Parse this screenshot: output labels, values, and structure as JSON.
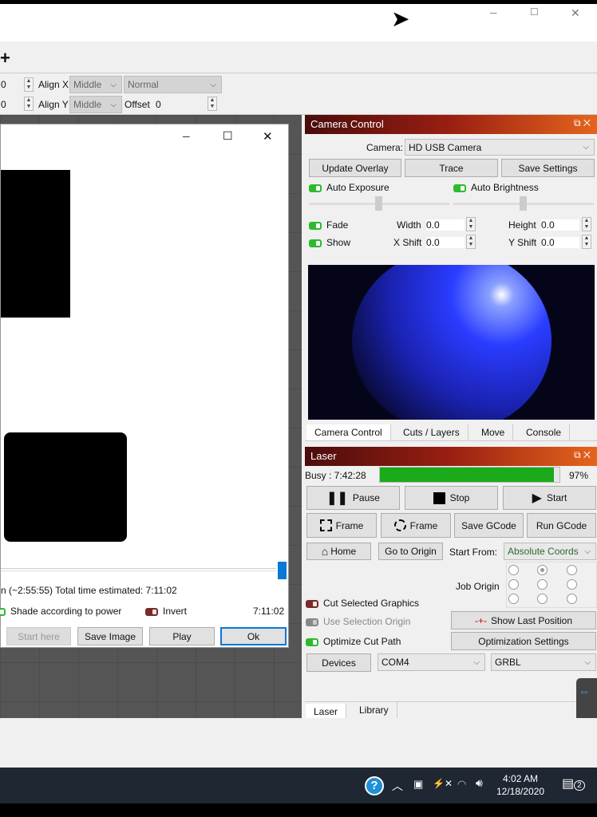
{
  "window": {
    "minimize": "─",
    "maximize": "☐",
    "close": "✕"
  },
  "toolbar": {
    "row1": {
      "value": "0",
      "align_x_label": "Align X",
      "align_x": "Middle",
      "mode": "Normal"
    },
    "row2": {
      "value": "0",
      "align_y_label": "Align Y",
      "align_y": "Middle",
      "offset_label": "Offset",
      "offset": "0"
    }
  },
  "preview_dialog": {
    "time_text": "n (~2:55:55)  Total time estimated: 7:11:02",
    "shade_label": "Shade according to power",
    "invert_label": "Invert",
    "elapsed": "7:11:02",
    "buttons": {
      "start_here": "Start here",
      "save_image": "Save Image",
      "play": "Play",
      "ok": "Ok"
    }
  },
  "camera": {
    "title": "Camera Control",
    "camera_label": "Camera:",
    "camera_value": "HD USB Camera",
    "update_overlay": "Update Overlay",
    "trace": "Trace",
    "save_settings": "Save Settings",
    "auto_exposure": "Auto Exposure",
    "auto_brightness": "Auto Brightness",
    "fade": "Fade",
    "show": "Show",
    "width_label": "Width",
    "width": "0.0",
    "height_label": "Height",
    "height": "0.0",
    "xshift_label": "X Shift",
    "xshift": "0.0",
    "yshift_label": "Y Shift",
    "yshift": "0.0"
  },
  "tabs_top": [
    "Camera Control",
    "Cuts / Layers",
    "Move",
    "Console"
  ],
  "laser": {
    "title": "Laser",
    "status": "Busy : 7:42:28",
    "progress_pct": 97,
    "progress_text": "97%",
    "pause": "Pause",
    "stop": "Stop",
    "start": "Start",
    "frame1": "Frame",
    "frame2": "Frame",
    "save_gcode": "Save GCode",
    "run_gcode": "Run GCode",
    "home": "Home",
    "go_to_origin": "Go to Origin",
    "start_from_label": "Start From:",
    "start_from": "Absolute Coords",
    "job_origin": "Job Origin",
    "cut_selected": "Cut Selected Graphics",
    "use_selection_origin": "Use Selection Origin",
    "optimize_cut_path": "Optimize Cut Path",
    "show_last_position": "Show Last Position",
    "optimization_settings": "Optimization Settings",
    "devices": "Devices",
    "port": "COM4",
    "controller": "GRBL",
    "accent": "#1aaa1a"
  },
  "tabs_bottom": [
    "Laser",
    "Library"
  ],
  "taskbar": {
    "time": "4:02 AM",
    "date": "12/18/2020",
    "notifications": "2"
  }
}
